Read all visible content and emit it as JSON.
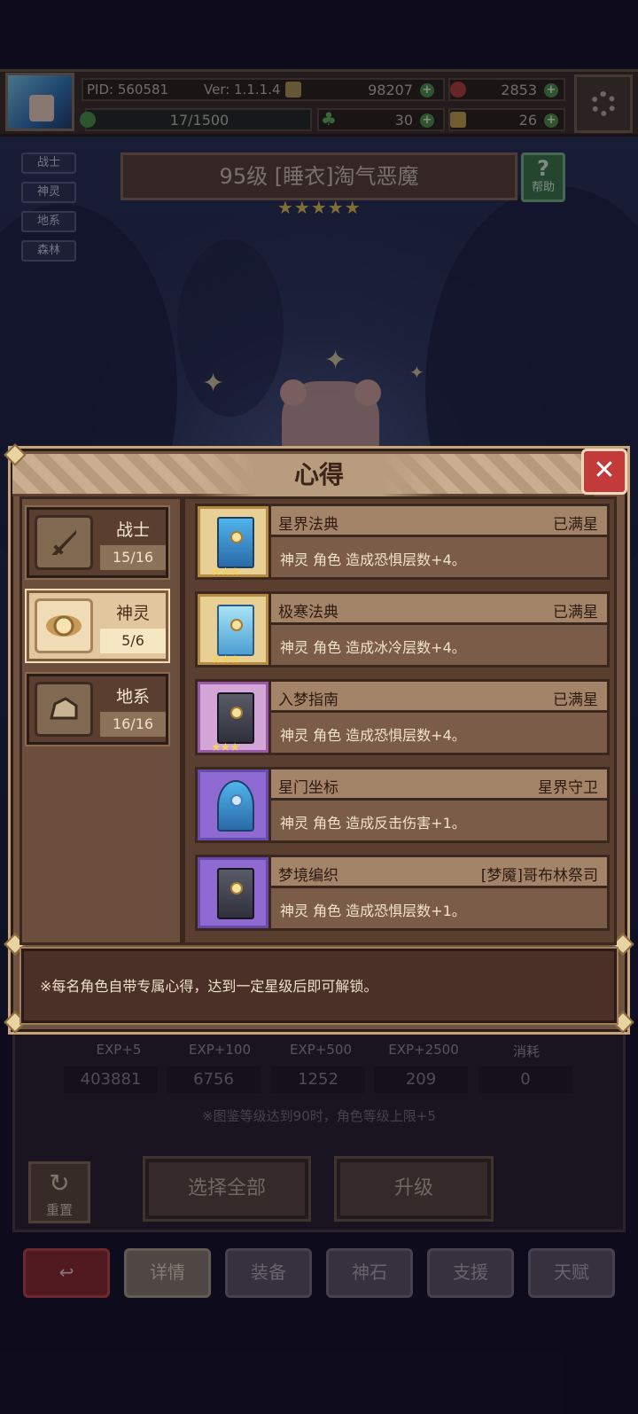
{
  "status_bar": {
    "pid": "PID: 560581",
    "version": "Ver: 1.1.1.4",
    "gold": "98207",
    "gems": "2853",
    "stamina": "17/1500",
    "clover": "30",
    "dice": "26"
  },
  "side_tags": [
    "战士",
    "神灵",
    "地系",
    "森林"
  ],
  "character": {
    "title": "95级  [睡衣]淘气恶魔",
    "stars": "★★★★★",
    "help_label": "帮助"
  },
  "modal": {
    "title": "心得",
    "close_symbol": "✕",
    "categories": [
      {
        "name": "战士",
        "count": "15/16",
        "active": false
      },
      {
        "name": "神灵",
        "count": "5/6",
        "active": true
      },
      {
        "name": "地系",
        "count": "16/16",
        "active": false
      }
    ],
    "items": [
      {
        "name": "星界法典",
        "status": "已满星",
        "desc": "神灵 角色 造成恐惧层数+4。",
        "stars": "★★★"
      },
      {
        "name": "极寒法典",
        "status": "已满星",
        "desc": "神灵 角色 造成冰冷层数+4。",
        "stars": "★★★"
      },
      {
        "name": "入梦指南",
        "status": "已满星",
        "desc": "神灵 角色 造成恐惧层数+4。",
        "stars": "★★★"
      },
      {
        "name": "星门坐标",
        "status": "星界守卫",
        "desc": "神灵 角色 造成反击伤害+1。",
        "stars": ""
      },
      {
        "name": "梦境编织",
        "status": "[梦魇]哥布林祭司",
        "desc": "神灵 角色 造成恐惧层数+1。",
        "stars": ""
      }
    ],
    "footer_note": "※每名角色自带专属心得，达到一定星级后即可解锁。"
  },
  "exp_panel": {
    "labels": [
      "EXP+5",
      "EXP+100",
      "EXP+500",
      "EXP+2500",
      "消耗"
    ],
    "values": [
      "403881",
      "6756",
      "1252",
      "209",
      "0"
    ],
    "note": "※图鉴等级达到90时，角色等级上限+5"
  },
  "actions": {
    "reset": "重置",
    "select_all": "选择全部",
    "upgrade": "升级"
  },
  "bottom_nav": [
    "详情",
    "装备",
    "神石",
    "支援",
    "天赋"
  ],
  "icons": {
    "back": "back-arrow-icon",
    "settings": "gear-icon",
    "close": "close-icon"
  },
  "colors": {
    "accent_red": "#c23a3a",
    "panel_brown": "#6f5240",
    "star_gold": "#f0d35a"
  }
}
